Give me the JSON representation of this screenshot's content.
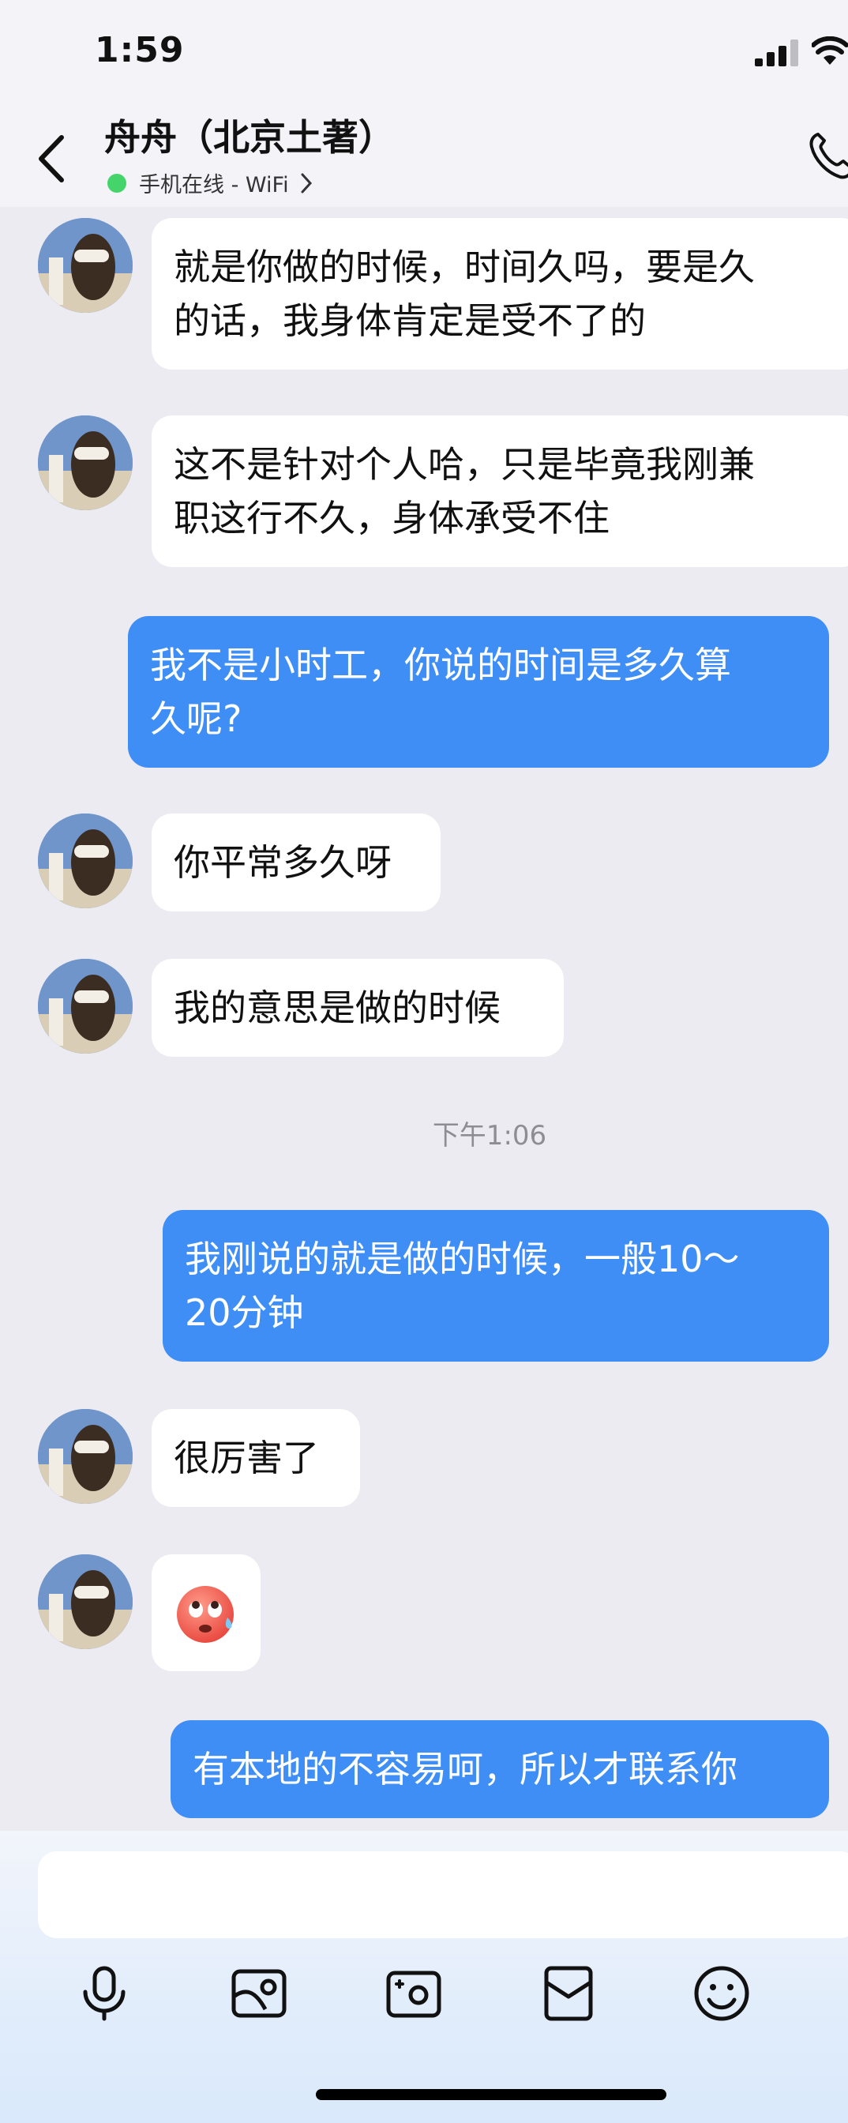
{
  "status_bar": {
    "time": "1:59"
  },
  "header": {
    "contact_name": "舟舟（北京土著）",
    "online_status": "手机在线 - WiFi"
  },
  "messages": [
    {
      "side": "in",
      "text": "就是你做的时候，时间久吗，要是久\n的话，我身体肯定是受不了的"
    },
    {
      "side": "in",
      "text": "这不是针对个人哈，只是毕竟我刚兼\n职这行不久，身体承受不住"
    },
    {
      "side": "out",
      "text": "我不是小时工，你说的时间是多久算\n久呢?"
    },
    {
      "side": "in",
      "text": "你平常多久呀"
    },
    {
      "side": "in",
      "text": "我的意思是做的时候"
    },
    {
      "side": "out",
      "text": "我刚说的就是做的时候，一般10～\n20分钟"
    },
    {
      "side": "in",
      "text": "很厉害了"
    },
    {
      "side": "in",
      "emoji": "face-with-rolling-eyes-sweat"
    },
    {
      "side": "out",
      "text": "有本地的不容易呵，所以才联系你"
    }
  ],
  "timestamp": "下午1:06",
  "input": {
    "placeholder": ""
  },
  "toolbar": [
    "microphone-icon",
    "image-icon",
    "camera-icon",
    "red-packet-icon",
    "emoji-icon"
  ],
  "colors": {
    "outgoing_bubble": "#3e8ef6",
    "incoming_bubble": "#ffffff",
    "online_dot": "#45d46a",
    "background": "#ecebf1"
  }
}
